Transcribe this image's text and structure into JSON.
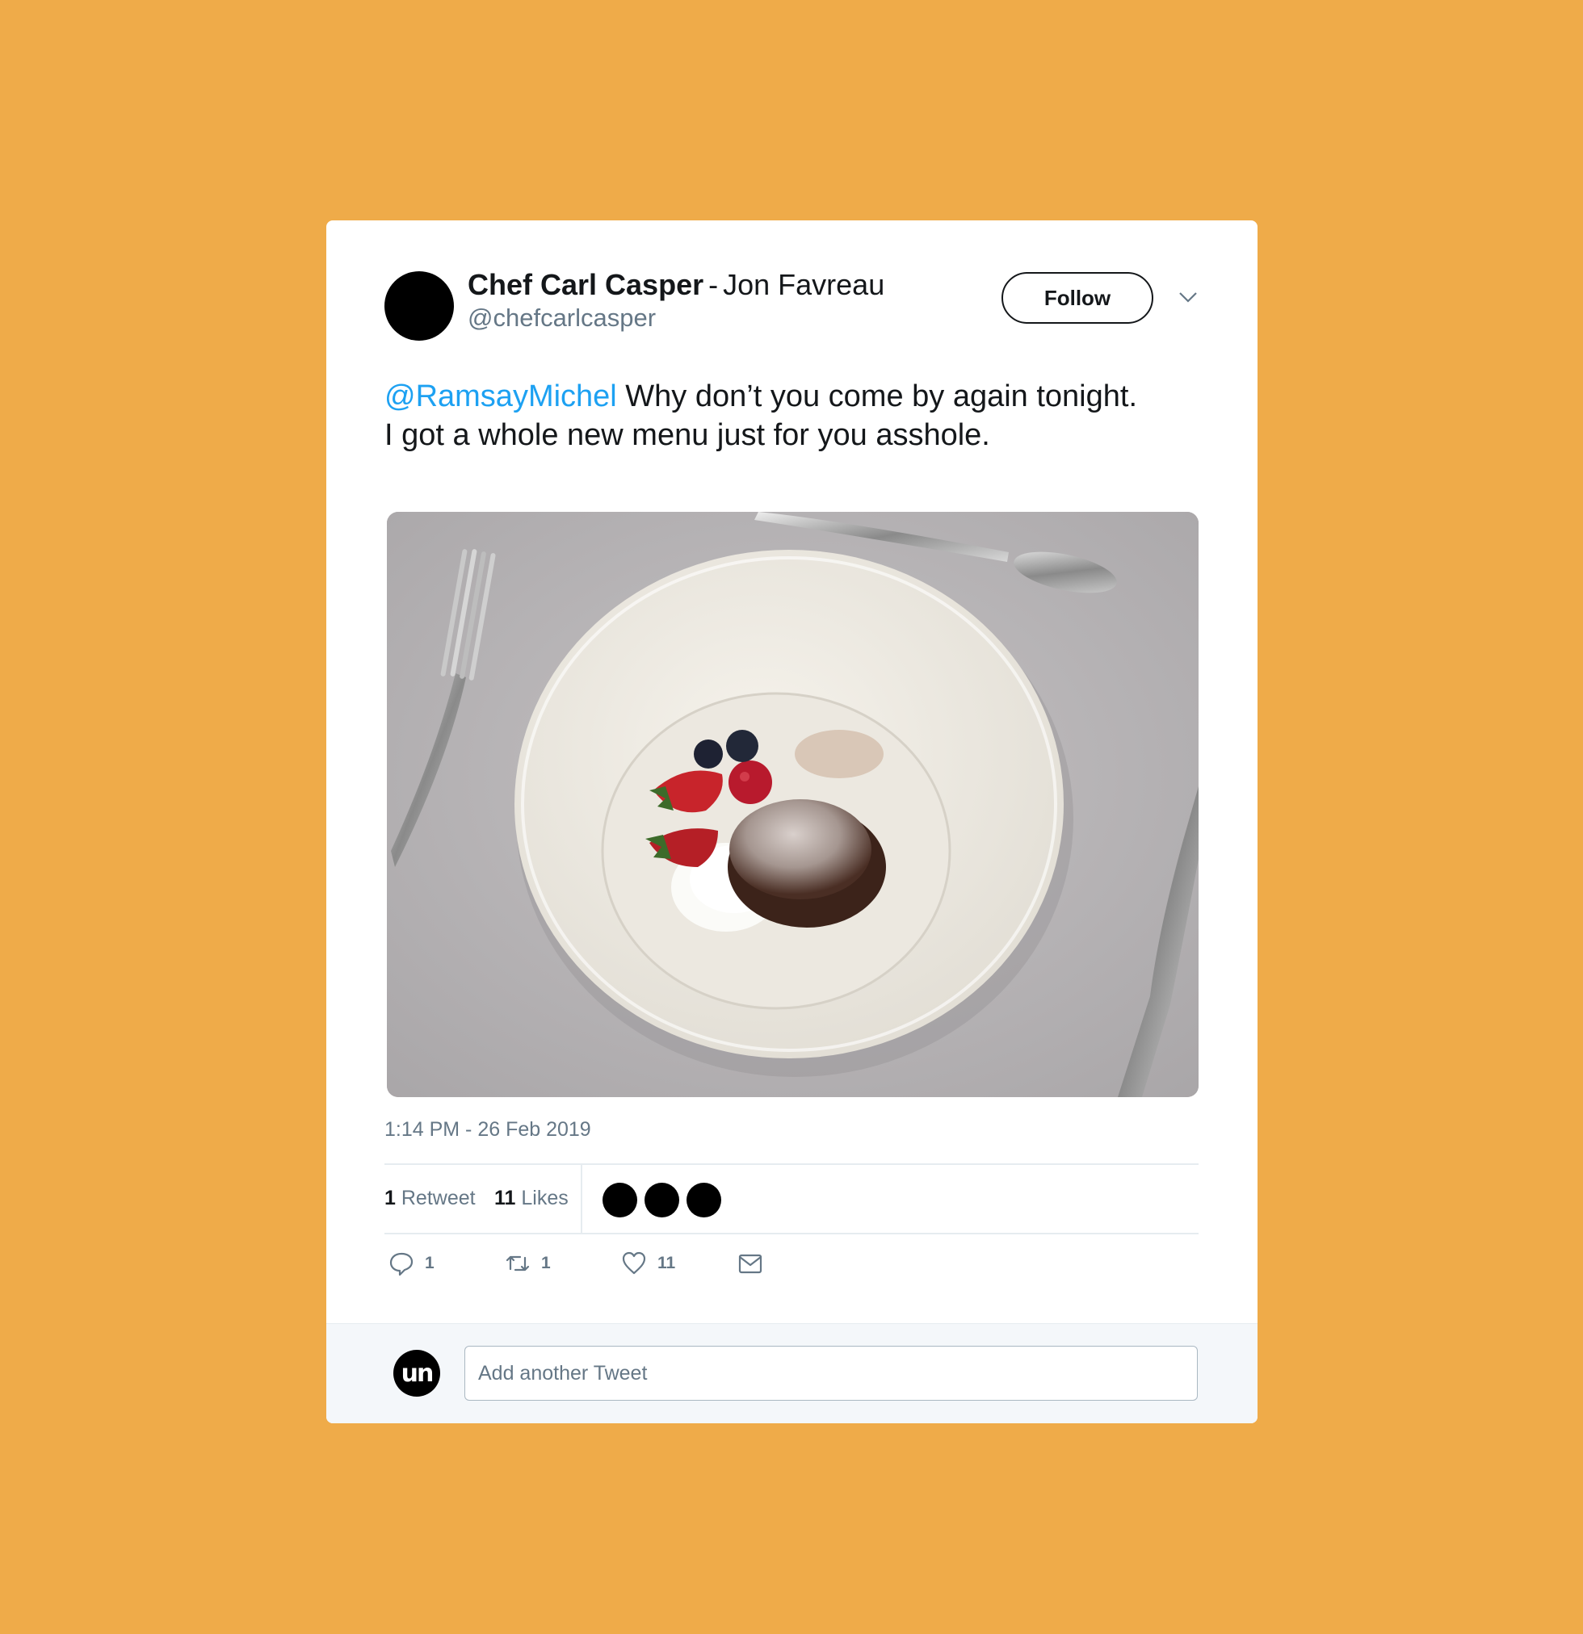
{
  "tweet": {
    "author": {
      "display_name": "Chef Carl Casper",
      "separator": "-",
      "actor": "Jon Favreau",
      "handle": "@chefcarlcasper"
    },
    "follow_label": "Follow",
    "text": {
      "mention": "@RamsayMichel",
      "line1_rest": " Why don’t you come by again tonight.",
      "line2": "I got a whole new menu just for you asshole."
    },
    "timestamp": "1:14 PM - 26 Feb 2019",
    "stats": {
      "retweets_count": "1",
      "retweets_label": "Retweet",
      "likes_count": "11",
      "likes_label": "Likes"
    },
    "actions": {
      "reply_count": "1",
      "retweet_count": "1",
      "like_count": "11"
    }
  },
  "composer": {
    "avatar_text": "un",
    "placeholder": "Add another Tweet"
  },
  "colors": {
    "background": "#EFAB49",
    "mention": "#1da1f2",
    "muted": "#657786"
  }
}
